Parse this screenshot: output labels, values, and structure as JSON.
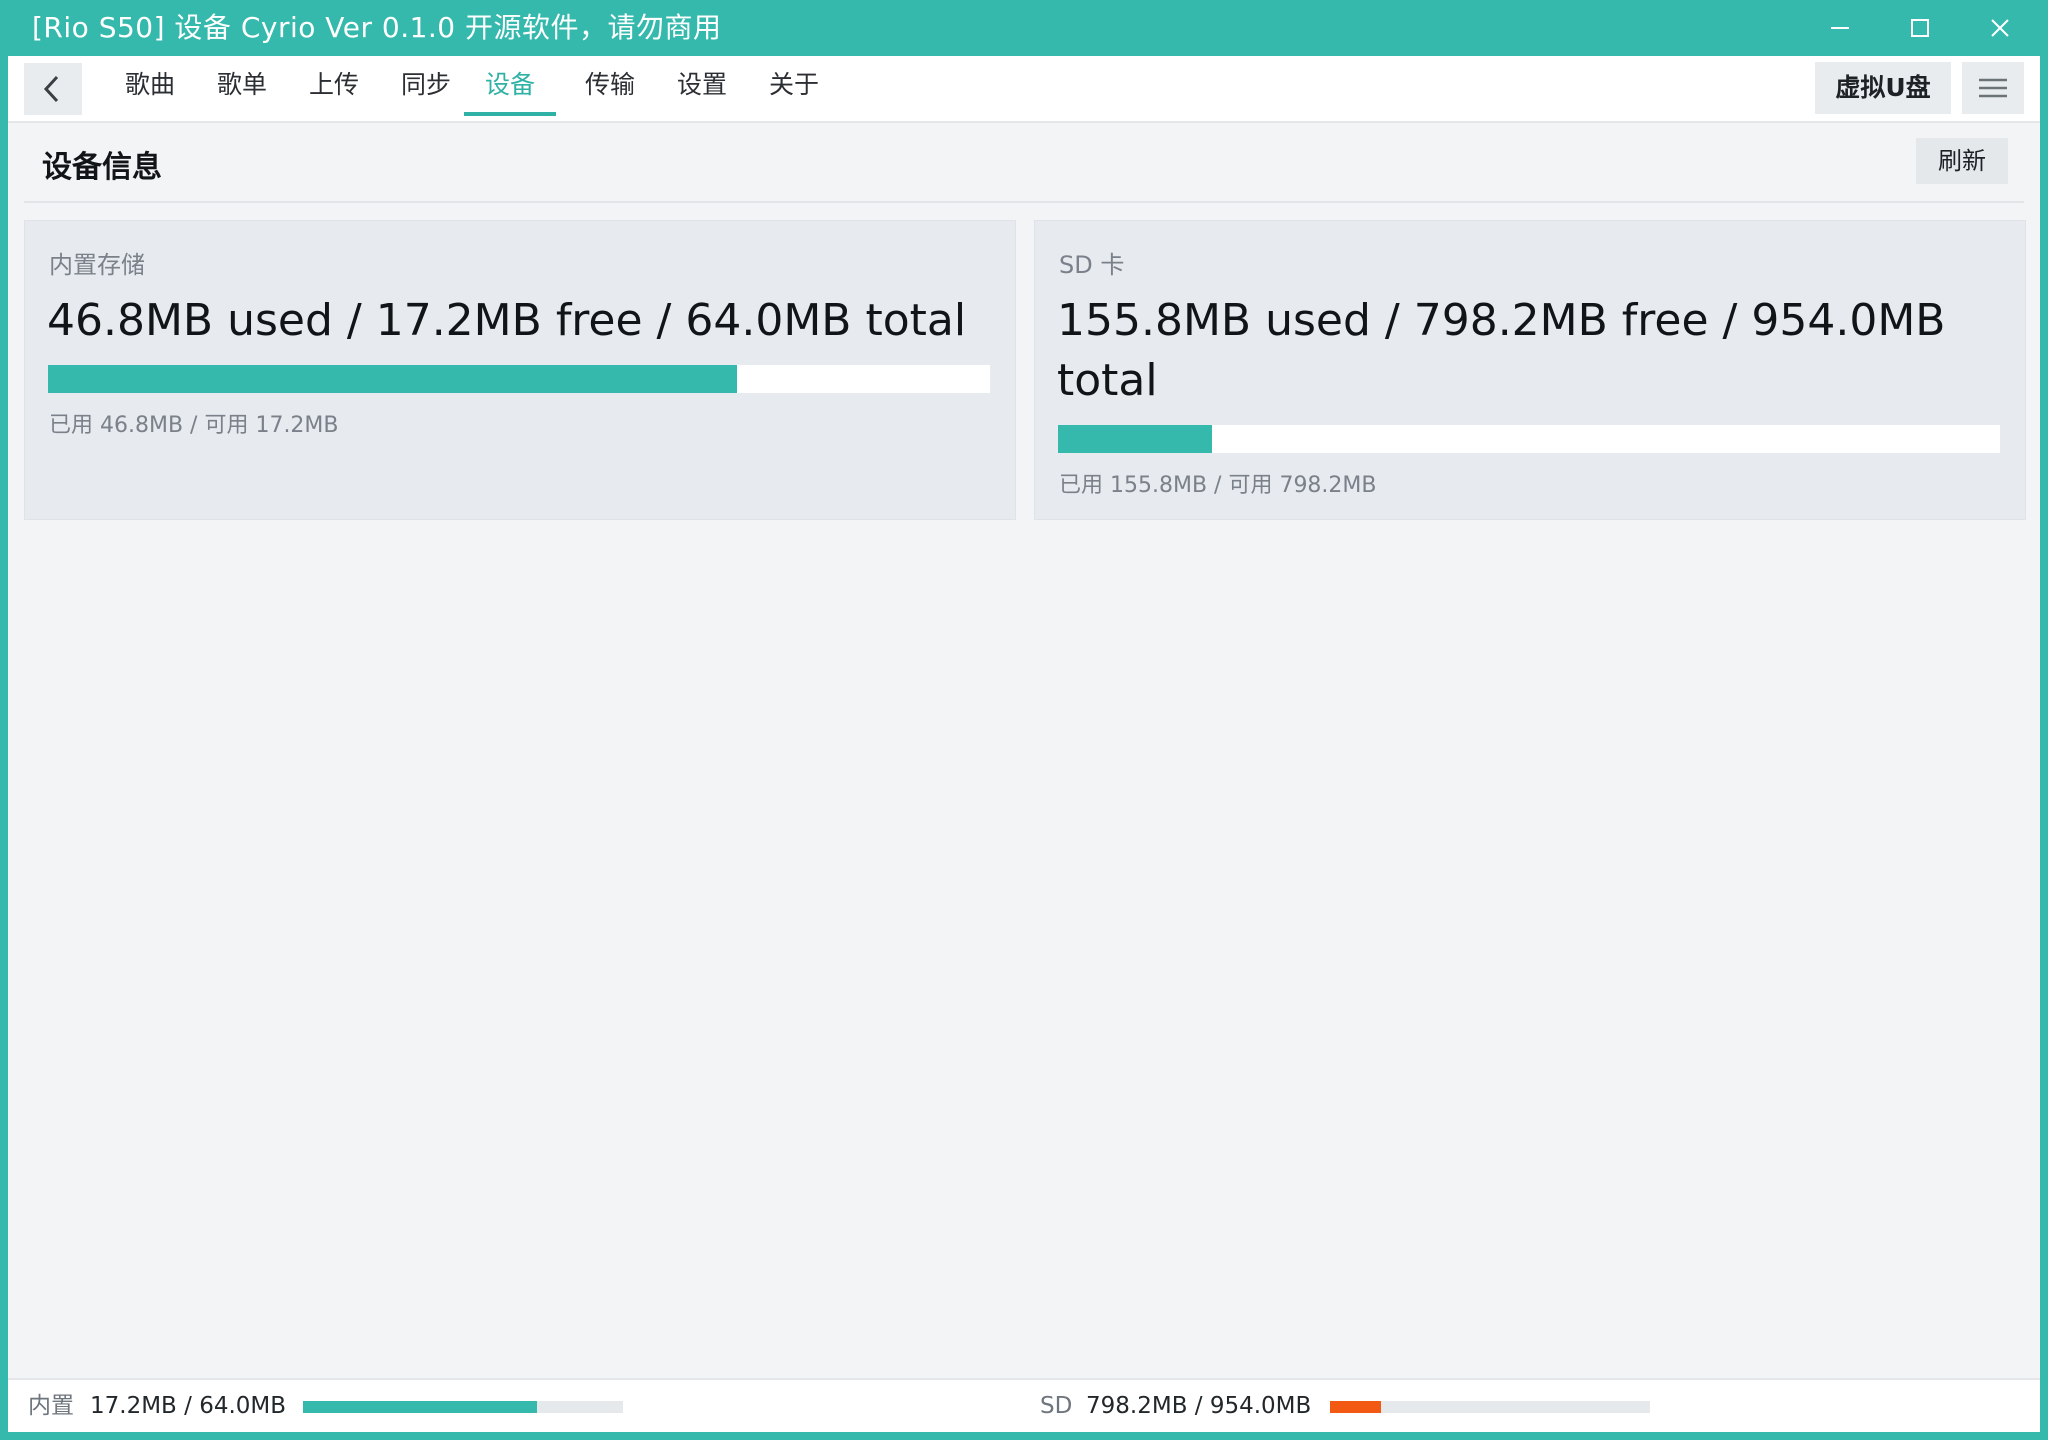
{
  "window": {
    "title": "[Rio S50] 设备 Cyrio Ver 0.1.0 开源软件，请勿商用",
    "accent_color": "#35b9ad"
  },
  "nav": {
    "back_icon": "chevron-left-icon",
    "tabs": [
      {
        "label": "歌曲",
        "active": false
      },
      {
        "label": "歌单",
        "active": false
      },
      {
        "label": "上传",
        "active": false
      },
      {
        "label": "同步",
        "active": false
      },
      {
        "label": "设备",
        "active": true
      },
      {
        "label": "传输",
        "active": false
      },
      {
        "label": "设置",
        "active": false
      },
      {
        "label": "关于",
        "active": false
      }
    ],
    "virtual_disk_label": "虚拟U盘",
    "menu_icon": "hamburger-menu-icon"
  },
  "section": {
    "title": "设备信息",
    "refresh_label": "刷新"
  },
  "storage": {
    "internal": {
      "label": "内置存储",
      "summary": "46.8MB used / 17.2MB free / 64.0MB total",
      "used_fraction": 0.731,
      "detail": "已用 46.8MB / 可用 17.2MB"
    },
    "sd": {
      "label": "SD 卡",
      "summary": "155.8MB used / 798.2MB free / 954.0MB total",
      "used_fraction": 0.163,
      "detail": "已用 155.8MB / 可用 798.2MB"
    }
  },
  "statusbar": {
    "internal": {
      "label": "内置",
      "value": "17.2MB / 64.0MB",
      "fill_fraction": 0.73,
      "color": "#35b9ad"
    },
    "sd": {
      "label": "SD",
      "value": "798.2MB / 954.0MB",
      "fill_fraction": 0.16,
      "color": "#f25a13"
    }
  }
}
